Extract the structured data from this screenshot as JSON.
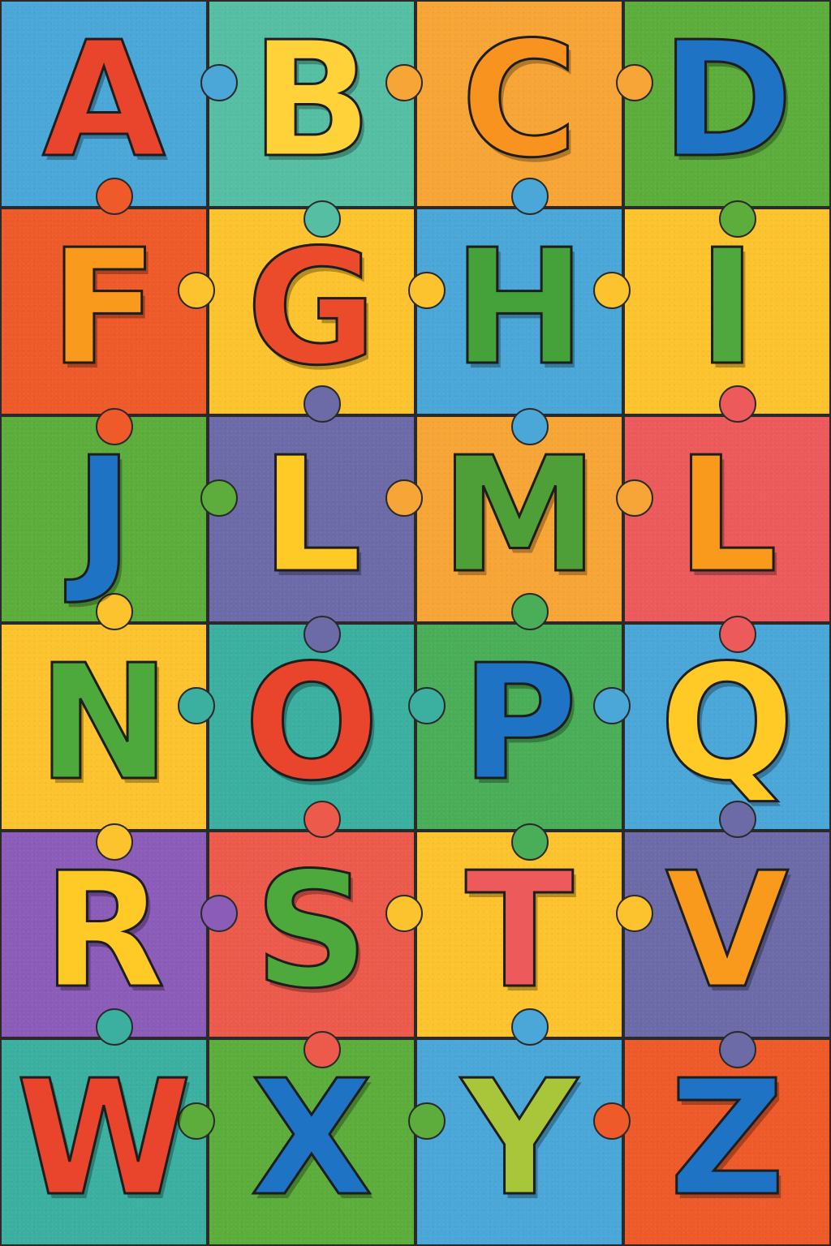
{
  "puzzle": {
    "pieces": [
      {
        "letter": "A",
        "bg": "#4aa7d8",
        "color": "#e8452c"
      },
      {
        "letter": "B",
        "bg": "#56bfa3",
        "color": "#ffd23a"
      },
      {
        "letter": "C",
        "bg": "#f7a536",
        "color": "#f7931e"
      },
      {
        "letter": "D",
        "bg": "#5cad3c",
        "color": "#1e73c4"
      },
      {
        "letter": "F",
        "bg": "#ee5a2a",
        "color": "#f99a1c"
      },
      {
        "letter": "G",
        "bg": "#fcc32e",
        "color": "#ec4b2b"
      },
      {
        "letter": "H",
        "bg": "#4aa7d8",
        "color": "#45a23a"
      },
      {
        "letter": "I",
        "bg": "#fcc32e",
        "color": "#4fa83d"
      },
      {
        "letter": "J",
        "bg": "#5cad3c",
        "color": "#1e73c4"
      },
      {
        "letter": "L",
        "bg": "#6d6aa8",
        "color": "#ffc926"
      },
      {
        "letter": "M",
        "bg": "#f7a536",
        "color": "#4f9f38"
      },
      {
        "letter": "L",
        "bg": "#ec5a5c",
        "color": "#f99a1c"
      },
      {
        "letter": "N",
        "bg": "#fcc32e",
        "color": "#4ea93c"
      },
      {
        "letter": "O",
        "bg": "#3bb0a0",
        "color": "#e8452c"
      },
      {
        "letter": "P",
        "bg": "#4aae58",
        "color": "#1e73c4"
      },
      {
        "letter": "Q",
        "bg": "#4aa7d8",
        "color": "#ffc926"
      },
      {
        "letter": "R",
        "bg": "#8b5cb8",
        "color": "#ffc926"
      },
      {
        "letter": "S",
        "bg": "#ec5a4c",
        "color": "#4ea93c"
      },
      {
        "letter": "T",
        "bg": "#fcc32e",
        "color": "#ec5a5c"
      },
      {
        "letter": "V",
        "bg": "#6d6aa8",
        "color": "#f99a1c"
      },
      {
        "letter": "W",
        "bg": "#3bb0a0",
        "color": "#e8452c"
      },
      {
        "letter": "X",
        "bg": "#5cad3c",
        "color": "#1e73c4"
      },
      {
        "letter": "Y",
        "bg": "#4aa7d8",
        "color": "#a9c63a"
      },
      {
        "letter": "Z",
        "bg": "#ee5a2a",
        "color": "#1e73c4"
      }
    ]
  }
}
